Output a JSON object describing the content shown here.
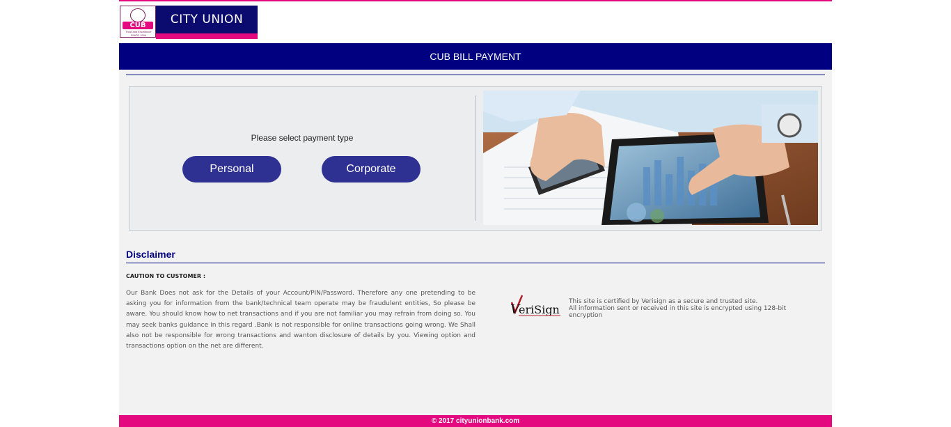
{
  "brand": {
    "bank_name": "CITY UNION BANK",
    "emblem_abbr": "CUB",
    "emblem_tagline": "Trust and Excellence",
    "emblem_since": "SINCE 1904",
    "colors": {
      "navy": "#000080",
      "pink": "#e5097f",
      "button": "#2e3192"
    }
  },
  "header": {
    "title": "CUB BILL PAYMENT"
  },
  "payment": {
    "prompt": "Please select payment type",
    "buttons": [
      {
        "label": "Personal"
      },
      {
        "label": "Corporate"
      }
    ],
    "hero_image": "hands-with-smartphone-and-tablet-charts"
  },
  "disclaimer": {
    "title": "Disclaimer",
    "caution_heading": "CAUTION TO CUSTOMER :",
    "body": "Our Bank Does not ask for the Details of your Account/PIN/Password. Therefore any one pretending to be asking you for information from the bank/technical team operate may be fraudulent entities, So please be aware. You should know how to net transactions and if you are not familiar you may refrain from doing so. You may seek banks guidance in this regard .Bank is not responsible for online transactions going wrong. We Shall also not be responsible for wrong transactions and wanton disclosure of details by you. Viewing option and transactions option on the net are different."
  },
  "verisign": {
    "logo_text": "VeriSign",
    "line1": "This site is certified by Verisign as a secure and trusted site.",
    "line2": "All information sent or received in this site is encrypted using 128-bit encryption"
  },
  "footer": {
    "copyright": "© 2017 cityunionbank.com"
  }
}
